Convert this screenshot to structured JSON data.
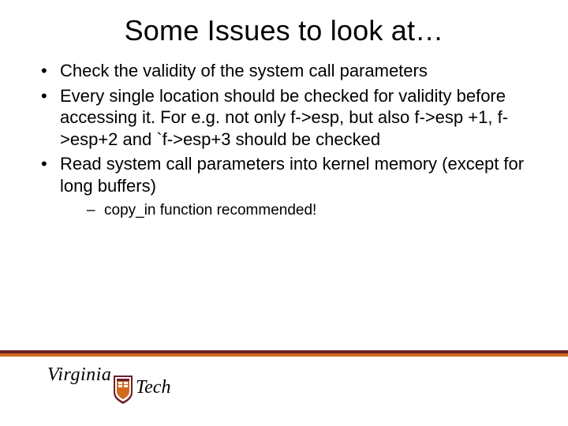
{
  "slide": {
    "title": "Some Issues to look at…",
    "bullets": [
      "Check the validity of the system call parameters",
      "Every single location should be checked for validity before accessing it. For e.g. not only f->esp, but also f->esp +1, f->esp+2 and `f->esp+3 should be checked",
      "Read system call parameters into kernel memory (except for long buffers)"
    ],
    "sub_bullets": [
      "copy_in function recommended!"
    ],
    "logo": {
      "word1": "Virginia",
      "word2": "Tech"
    }
  }
}
